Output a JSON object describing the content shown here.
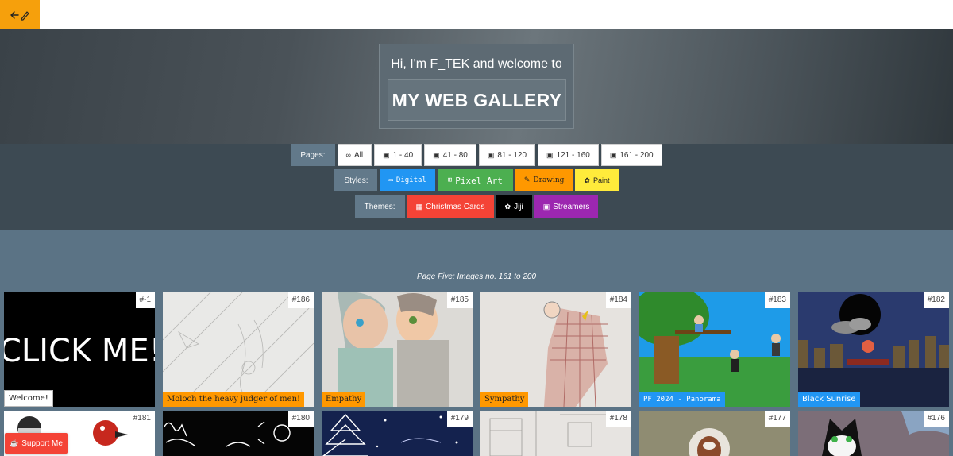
{
  "header": {
    "back_icon": "arrow-left-pencil-icon",
    "accent": "#f6a00c"
  },
  "hero": {
    "subtitle": "Hi, I'm F_TEK and welcome to",
    "title": "MY WEB GALLERY"
  },
  "filters": {
    "pages_label": "Pages:",
    "pages": [
      {
        "icon": "∞",
        "label": "All"
      },
      {
        "icon": "▣",
        "label": "1 - 40"
      },
      {
        "icon": "▣",
        "label": "41 - 80"
      },
      {
        "icon": "▣",
        "label": "81 - 120"
      },
      {
        "icon": "▣",
        "label": "121 - 160"
      },
      {
        "icon": "▣",
        "label": "161 - 200"
      }
    ],
    "styles_label": "Styles:",
    "styles": [
      {
        "icon": "▭",
        "label": "Digital",
        "color": "#2196f3"
      },
      {
        "icon": "⊞",
        "label": "Pixel Art",
        "color": "#4caf50"
      },
      {
        "icon": "✎",
        "label": "Drawing",
        "color": "#ff9800"
      },
      {
        "icon": "✿",
        "label": "Paint",
        "color": "#ffeb3b"
      }
    ],
    "themes_label": "Themes:",
    "themes": [
      {
        "icon": "▦",
        "label": "Christmas Cards",
        "color": "#f44336"
      },
      {
        "icon": "✿",
        "label": "Jiji",
        "color": "#000000"
      },
      {
        "icon": "▣",
        "label": "Streamers",
        "color": "#9c27b0"
      }
    ]
  },
  "gallery": {
    "caption": "Page Five: Images no. 161 to 200",
    "row1": [
      {
        "num": "#-1",
        "caption": "Welcome!",
        "art_text": "CLICK ME!"
      },
      {
        "num": "#186",
        "caption": "Moloch the heavy judger of men!"
      },
      {
        "num": "#185",
        "caption": "Empathy"
      },
      {
        "num": "#184",
        "caption": "Sympathy"
      },
      {
        "num": "#183",
        "caption": "PF 2024 - Panorama"
      },
      {
        "num": "#182",
        "caption": "Black Sunrise"
      }
    ],
    "row2": [
      {
        "num": "#181"
      },
      {
        "num": "#180"
      },
      {
        "num": "#179"
      },
      {
        "num": "#178"
      },
      {
        "num": "#177"
      },
      {
        "num": "#176"
      }
    ]
  },
  "support": {
    "label": "Support Me"
  }
}
